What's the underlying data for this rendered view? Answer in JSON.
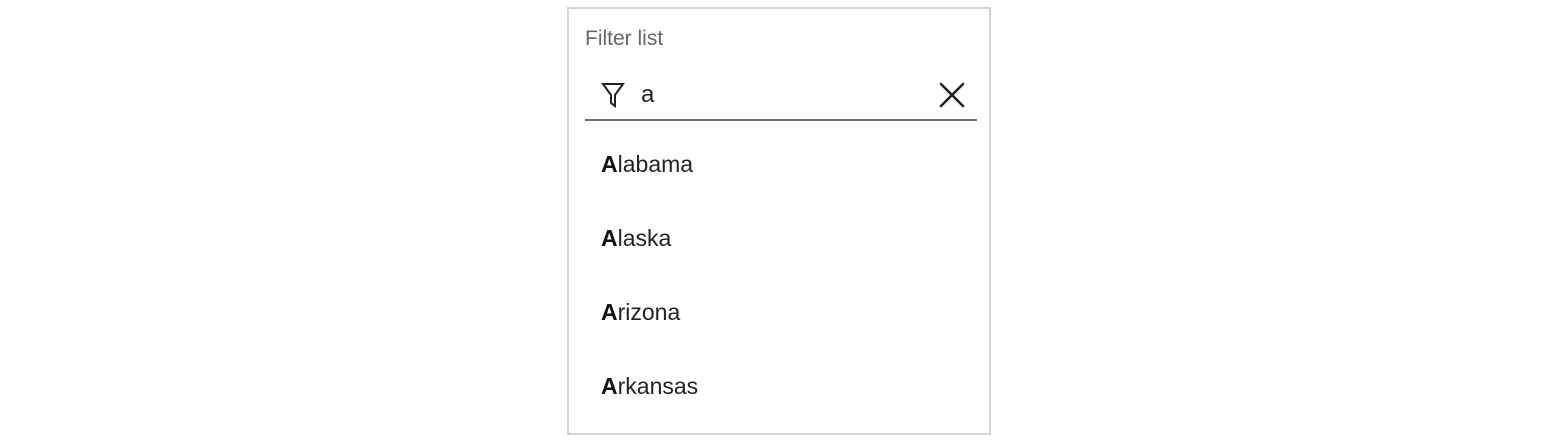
{
  "filter": {
    "label": "Filter list",
    "value": "a",
    "icon": "filter-icon",
    "clear_icon": "close-icon"
  },
  "results": [
    {
      "match": "A",
      "rest": "labama"
    },
    {
      "match": "A",
      "rest": "laska"
    },
    {
      "match": "A",
      "rest": "rizona"
    },
    {
      "match": "A",
      "rest": "rkansas"
    }
  ],
  "colors": {
    "border": "#d4d4d4",
    "underline": "#6e6e6e",
    "label": "#666666",
    "text": "#222222"
  }
}
